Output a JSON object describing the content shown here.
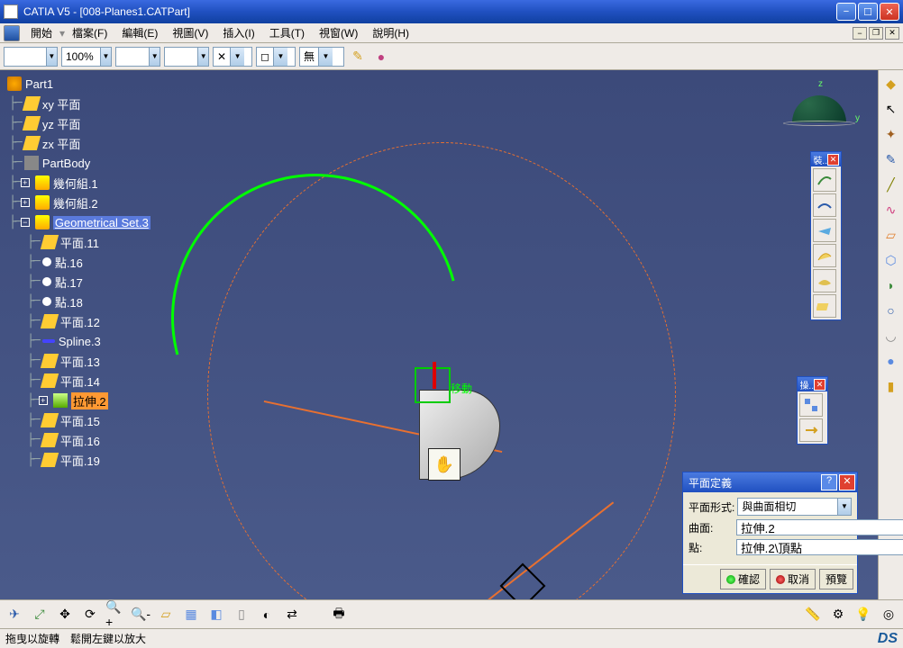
{
  "title": "CATIA V5 - [008-Planes1.CATPart]",
  "menu": {
    "start": "開始",
    "items": [
      "檔案(F)",
      "編輯(E)",
      "視圖(V)",
      "插入(I)",
      "工具(T)",
      "視窗(W)",
      "說明(H)"
    ]
  },
  "toolbar": {
    "zoom": "100%",
    "none": "無"
  },
  "tree": {
    "root": "Part1",
    "items": [
      {
        "icon": "plane",
        "label": "xy 平面"
      },
      {
        "icon": "plane",
        "label": "yz 平面"
      },
      {
        "icon": "plane",
        "label": "zx 平面"
      },
      {
        "icon": "body",
        "label": "PartBody"
      },
      {
        "icon": "geo",
        "label": "幾何組.1",
        "plus": true
      },
      {
        "icon": "geo",
        "label": "幾何組.2",
        "plus": true
      },
      {
        "icon": "geo",
        "label": "Geometrical Set.3",
        "geosel": true,
        "minus": true
      },
      {
        "icon": "plane",
        "label": "平面.11",
        "indent": 1
      },
      {
        "icon": "point",
        "label": "點.16",
        "indent": 1
      },
      {
        "icon": "point",
        "label": "點.17",
        "indent": 1
      },
      {
        "icon": "point",
        "label": "點.18",
        "indent": 1
      },
      {
        "icon": "plane",
        "label": "平面.12",
        "indent": 1
      },
      {
        "icon": "spline",
        "label": "Spline.3",
        "indent": 1
      },
      {
        "icon": "plane",
        "label": "平面.13",
        "indent": 1
      },
      {
        "icon": "plane",
        "label": "平面.14",
        "indent": 1
      },
      {
        "icon": "extrude",
        "label": "拉伸.2",
        "indent": 1,
        "sel": true,
        "plus": true
      },
      {
        "icon": "plane",
        "label": "平面.15",
        "indent": 1
      },
      {
        "icon": "plane",
        "label": "平面.16",
        "indent": 1
      },
      {
        "icon": "plane",
        "label": "平面.19",
        "indent": 1
      }
    ]
  },
  "viewport": {
    "manip_label": "移動",
    "hand": "✋"
  },
  "float1": {
    "title": "裝.."
  },
  "float2": {
    "title": "操.."
  },
  "dialog": {
    "title": "平面定義",
    "type_label": "平面形式:",
    "type_value": "與曲面相切",
    "surface_label": "曲面:",
    "surface_value": "拉伸.2",
    "point_label": "點:",
    "point_value": "拉伸.2\\頂點",
    "ok": "確認",
    "cancel": "取消",
    "preview": "預覽"
  },
  "status": "拖曳以旋轉　鬆開左鍵以放大",
  "compass": {
    "z": "z",
    "y": "y"
  }
}
